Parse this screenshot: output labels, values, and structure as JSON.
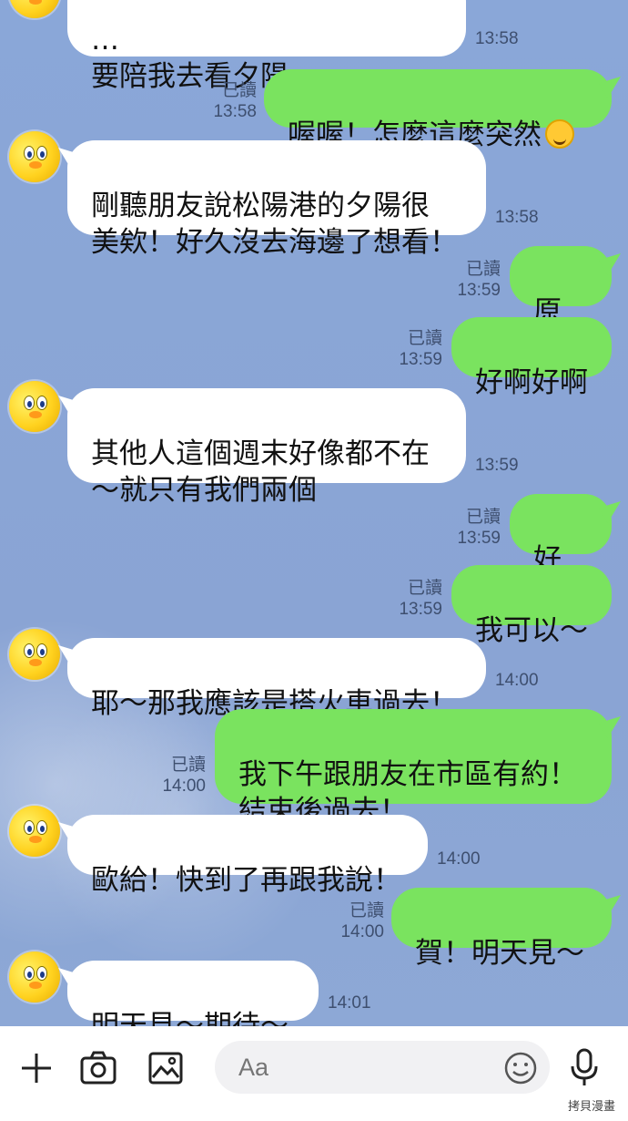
{
  "messages": [
    {
      "side": "in",
      "text": "…\n要陪我去看夕陽～",
      "time": "13:58"
    },
    {
      "side": "out",
      "text": "喔喔！怎麼這麼突然",
      "read": "已讀",
      "time": "13:58",
      "emoji": "rofl"
    },
    {
      "side": "in",
      "text": "剛聽朋友說松陽港的夕陽很\n美欸！好久沒去海邊了想看！",
      "time": "13:58"
    },
    {
      "side": "out",
      "text": "原來",
      "read": "已讀",
      "time": "13:59"
    },
    {
      "side": "out",
      "text": "好啊好啊",
      "read": "已讀",
      "time": "13:59"
    },
    {
      "side": "in",
      "text": "其他人這個週末好像都不在\n～就只有我們兩個",
      "time": "13:59"
    },
    {
      "side": "out",
      "text": "好啊",
      "read": "已讀",
      "time": "13:59"
    },
    {
      "side": "out",
      "text": "我可以～",
      "read": "已讀",
      "time": "13:59"
    },
    {
      "side": "in",
      "text": "耶～那我應該是搭火車過去！",
      "time": "14:00"
    },
    {
      "side": "out",
      "text": "我下午跟朋友在市區有約！\n結束後過去！",
      "read": "已讀",
      "time": "14:00"
    },
    {
      "side": "in",
      "text": "歐給！快到了再跟我說！",
      "time": "14:00"
    },
    {
      "side": "out",
      "text": "賀！明天見～",
      "read": "已讀",
      "time": "14:00"
    },
    {
      "side": "in",
      "text": "明天見～期待～",
      "time": "14:01"
    }
  ],
  "input": {
    "placeholder": "Aa"
  },
  "icons": {
    "plus": "plus-icon",
    "camera": "camera-icon",
    "image": "image-icon",
    "emoji": "emoji-icon",
    "mic": "microphone-icon"
  },
  "colors": {
    "outgoing_bubble": "#7ae35f",
    "incoming_bubble": "#ffffff",
    "background": "#8aa7d8"
  },
  "watermark": "拷貝漫畫"
}
